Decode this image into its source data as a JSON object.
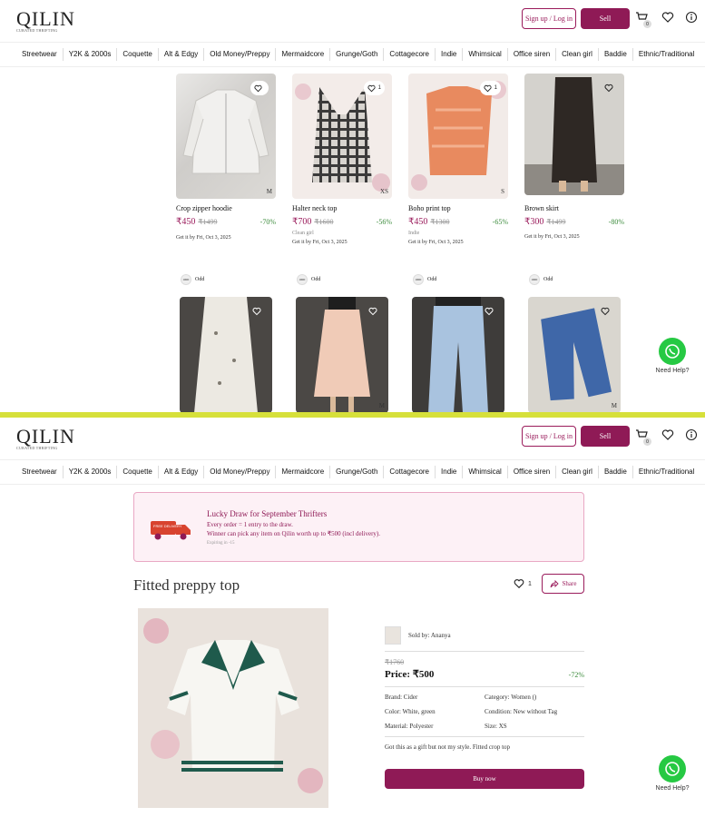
{
  "header": {
    "logo": "QILIN",
    "logo_tagline": "CURATED THRIFTING",
    "signup_label": "Sign up / Log in",
    "sell_label": "Sell",
    "cart_count": "0"
  },
  "nav": [
    "Streetwear",
    "Y2K & 2000s",
    "Coquette",
    "Alt & Edgy",
    "Old Money/Preppy",
    "Mermaidcore",
    "Grunge/Goth",
    "Cottagecore",
    "Indie",
    "Whimsical",
    "Office siren",
    "Clean girl",
    "Baddie",
    "Ethnic/Traditional"
  ],
  "listing": {
    "products": [
      {
        "name": "Crop zipper hoodie",
        "price": "₹450",
        "mrp": "₹1499",
        "discount": "-70%",
        "tag": "",
        "eta_prefix": "Get it by ",
        "eta_date": "Fri, Oct 3, 2025",
        "likes": "",
        "size": "M"
      },
      {
        "name": "Halter neck top",
        "price": "₹700",
        "mrp": "₹1600",
        "discount": "-56%",
        "tag": "Clean girl",
        "eta_prefix": "Get it by ",
        "eta_date": "Fri, Oct 3, 2025",
        "likes": "1",
        "size": "XS"
      },
      {
        "name": "Boho print top",
        "price": "₹450",
        "mrp": "₹1300",
        "discount": "-65%",
        "tag": "Indie",
        "eta_prefix": "Get it by ",
        "eta_date": "Fri, Oct 3, 2025",
        "likes": "1",
        "size": "S"
      },
      {
        "name": "Brown skirt",
        "price": "₹300",
        "mrp": "₹1499",
        "discount": "-80%",
        "tag": "",
        "eta_prefix": "Get it by ",
        "eta_date": "Fri, Oct 3, 2025",
        "likes": "",
        "size": ""
      }
    ],
    "second_row": [
      {
        "seller": "Odd",
        "avatar_text": "ODD",
        "size": ""
      },
      {
        "seller": "Odd",
        "avatar_text": "ODD",
        "size": "M"
      },
      {
        "seller": "Odd",
        "avatar_text": "ODD",
        "size": ""
      },
      {
        "seller": "Odd",
        "avatar_text": "ODD",
        "size": "M"
      }
    ]
  },
  "whatsapp": {
    "label": "Need Help?"
  },
  "banner": {
    "badge": "FREE DELIVERY",
    "title": "Lucky Draw for September Thrifters",
    "line1": "Every order = 1 entry to the draw.",
    "line2": "Winner can pick any item on Qilin worth up to ₹500 (incl delivery).",
    "expiry": "Expiring in -15"
  },
  "product": {
    "title": "Fitted preppy top",
    "likes": "1",
    "share_label": "Share",
    "sold_by": "Sold by: Ananya",
    "mrp": "₹1760",
    "price": "Price: ₹500",
    "discount": "-72%",
    "attributes": {
      "brand": "Brand: Cider",
      "category": "Category: Women ()",
      "color": "Color: White, green",
      "condition": "Condition: New without Tag",
      "material": "Material: Polyester",
      "size": "Size: XS"
    },
    "description": "Got this as a gift but not my style. Fitted crop top",
    "buy_label": "Buy now"
  },
  "colors": {
    "brand": "#8f1a56",
    "discount": "#3a8a3a",
    "divider": "#d6e03a",
    "whatsapp": "#26c943"
  }
}
